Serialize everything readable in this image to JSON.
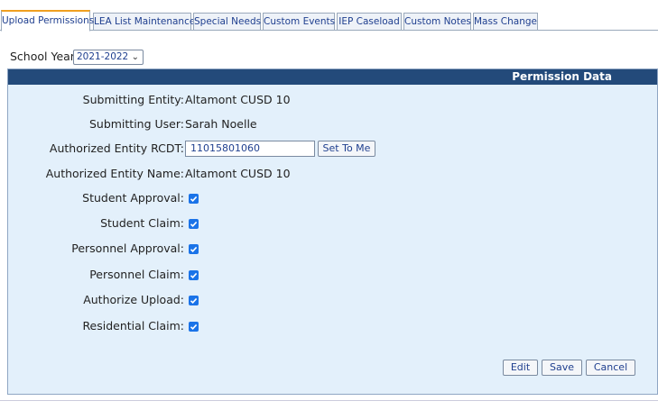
{
  "tabs": [
    {
      "label": "Upload Permissions",
      "active": true
    },
    {
      "label": "LEA List Maintenance",
      "active": false
    },
    {
      "label": "Special Needs",
      "active": false
    },
    {
      "label": "Custom Events",
      "active": false
    },
    {
      "label": "IEP Caseload",
      "active": false
    },
    {
      "label": "Custom Notes",
      "active": false
    },
    {
      "label": "Mass Change",
      "active": false
    }
  ],
  "school_year": {
    "label": "School Year:",
    "selected": "2021-2022"
  },
  "panel": {
    "title": "Permission Data",
    "fields": {
      "submitting_entity": {
        "label": "Submitting Entity:",
        "value": "Altamont CUSD 10"
      },
      "submitting_user": {
        "label": "Submitting User:",
        "value": "Sarah Noelle"
      },
      "authorized_rcdt": {
        "label": "Authorized Entity RCDT:",
        "value": "11015801060",
        "button": "Set To Me"
      },
      "authorized_name": {
        "label": "Authorized Entity Name:",
        "value": "Altamont CUSD 10"
      }
    },
    "checkboxes": [
      {
        "label": "Student Approval:",
        "checked": true
      },
      {
        "label": "Student Claim:",
        "checked": true
      },
      {
        "label": "Personnel Approval:",
        "checked": true
      },
      {
        "label": "Personnel Claim:",
        "checked": true
      },
      {
        "label": "Authorize Upload:",
        "checked": true
      },
      {
        "label": "Residential Claim:",
        "checked": true
      }
    ],
    "actions": {
      "edit": "Edit",
      "save": "Save",
      "cancel": "Cancel"
    }
  },
  "colors": {
    "header_bg": "#234a7a",
    "panel_bg": "#e3f0fb",
    "checkbox": "#1a73e8",
    "active_tab_accent": "#f0a020"
  }
}
